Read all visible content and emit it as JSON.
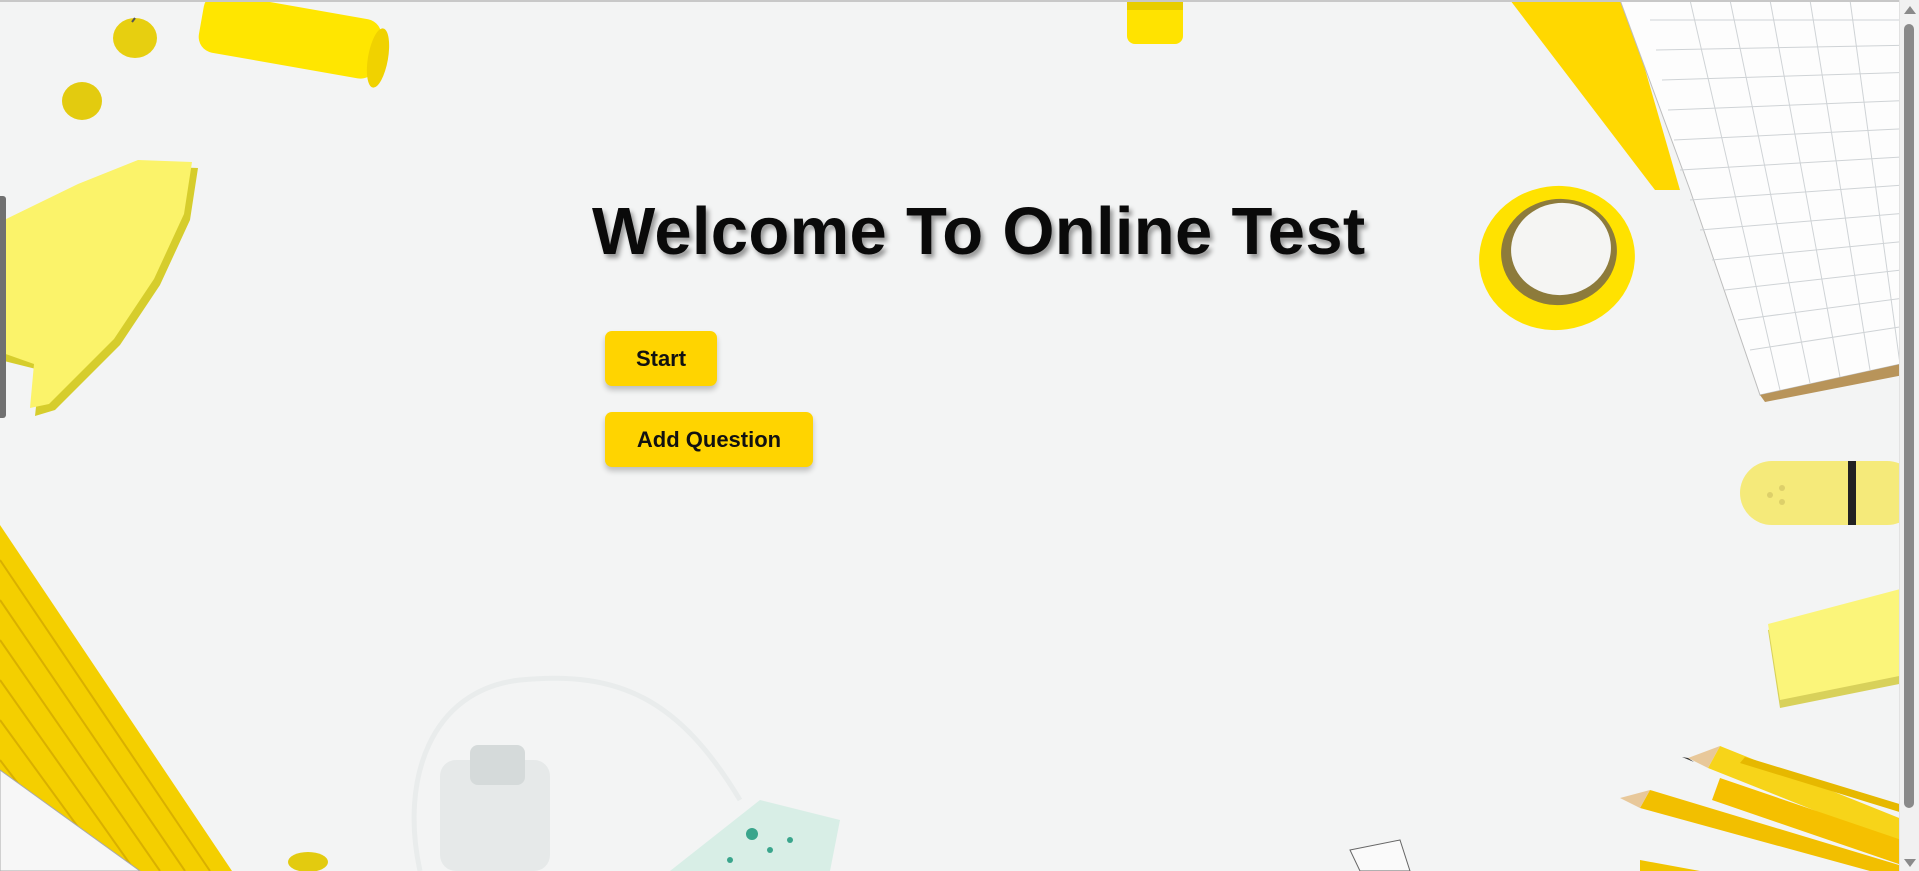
{
  "page": {
    "title": "Welcome To Online Test"
  },
  "actions": {
    "start_label": "Start",
    "add_question_label": "Add Question"
  },
  "colors": {
    "accent": "#ffd400",
    "background": "#f3f4f4",
    "text": "#0a0a0a"
  },
  "icons": {
    "scroll_up": "chevron-up-icon",
    "scroll_down": "chevron-down-icon"
  }
}
